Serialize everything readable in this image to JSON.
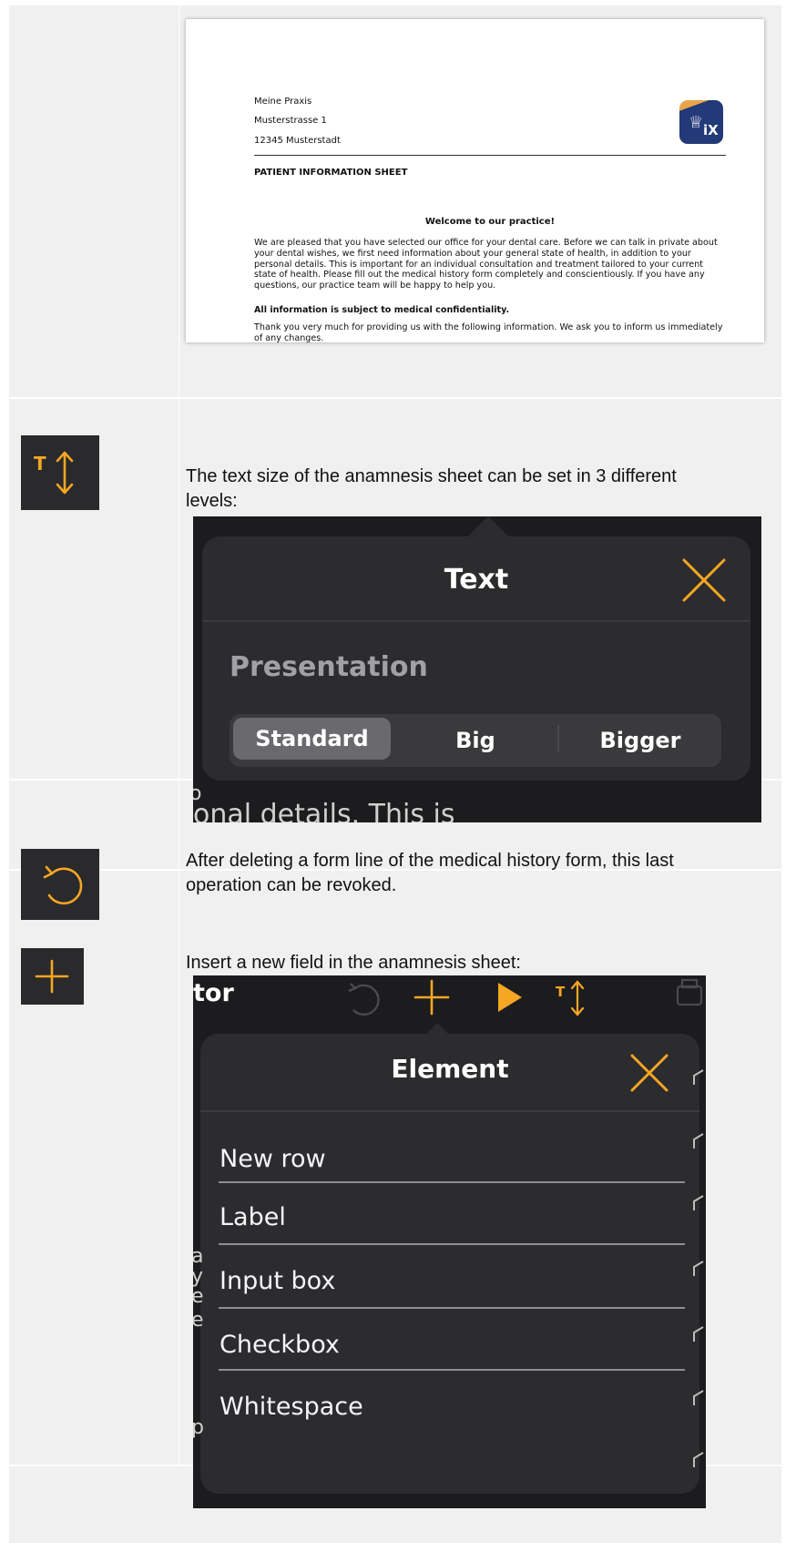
{
  "sheet": {
    "practice_name": "Meine Praxis",
    "street": "Musterstrasse  1",
    "city": "12345 Musterstadt",
    "logo_text": "iX",
    "title": "PATIENT INFORMATION SHEET",
    "welcome": "Welcome to our practice!",
    "intro": "We are pleased that you have selected our office for your dental care. Before we can talk in private about your dental wishes, we first need information about your general state of health, in addition to your personal details. This is important for an individual consultation and treatment tailored to your current state of health. Please fill out the medical history form completely and conscientiously. If you have any questions, our practice team will be happy to help you.",
    "confidential": "All information is subject to medical confidentiality.",
    "thanks": "Thank you very much for providing us with the following information. We ask you to inform us immediately of any changes."
  },
  "rows": [
    {
      "icon": "text-size-icon",
      "description": "The text size of the anamnesis sheet can be set in 3 different levels:",
      "popover": {
        "title": "Text",
        "section_label": "Presentation",
        "options": [
          "Standard",
          "Big",
          "Bigger"
        ],
        "selected": "Standard",
        "background_text": "onal details. This is"
      }
    },
    {
      "icon": "undo-icon",
      "description": "After deleting a form line of the medical history form, this last operation can be revoked."
    },
    {
      "icon": "plus-icon",
      "description": "Insert a new field in the anamnesis sheet:",
      "popover": {
        "toolbar_title": "tor",
        "title": "Element",
        "items": [
          "New row",
          "Label",
          "Input box",
          "Checkbox",
          "Whitespace"
        ]
      }
    }
  ],
  "colors": {
    "accent": "#f5a623",
    "dark_bg": "#2a2a2c",
    "popover_bg": "#2c2c2e",
    "table_bg": "#f0f0f0"
  }
}
